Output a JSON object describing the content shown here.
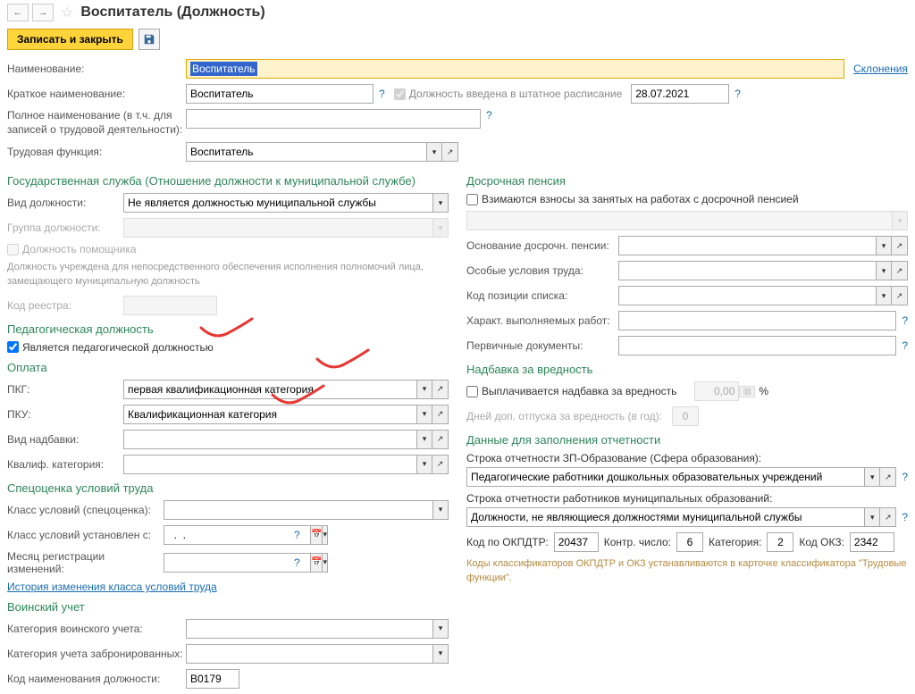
{
  "header": {
    "title": "Воспитатель (Должность)"
  },
  "actions": {
    "save_close": "Записать и закрыть"
  },
  "fields": {
    "name_label": "Наименование:",
    "name_value": "Воспитатель",
    "declensions_link": "Склонения",
    "short_name_label": "Краткое наименование:",
    "short_name_value": "Воспитатель",
    "in_schedule_label": "Должность введена в штатное расписание",
    "in_schedule_date": "28.07.2021",
    "full_name_label": "Полное наименование (в т.ч. для записей о трудовой деятельности):",
    "full_name_value": "",
    "labor_func_label": "Трудовая функция:",
    "labor_func_value": "Воспитатель"
  },
  "gov": {
    "header": "Государственная служба (Отношение должности к муниципальной службе)",
    "type_label": "Вид должности:",
    "type_value": "Не является должностью муниципальной службы",
    "group_label": "Группа должности:",
    "assistant_label": "Должность помощника",
    "assistant_note": "Должность учреждена для непосредственного обеспечения исполнения полномочий лица, замещающего муниципальную должность",
    "registry_label": "Код реестра:"
  },
  "pedagogical": {
    "header": "Педагогическая должность",
    "is_ped_label": "Является педагогической должностью"
  },
  "payment": {
    "header": "Оплата",
    "pkg_label": "ПКГ:",
    "pkg_value": "первая квалификационная категория",
    "pku_label": "ПКУ:",
    "pku_value": "Квалификационная категория",
    "bonus_label": "Вид надбавки:",
    "qualif_label": "Квалиф. категория:"
  },
  "special": {
    "header": "Спецоценка условий труда",
    "class_label": "Класс условий (спецоценка):",
    "class_from_label": "Класс условий установлен с:",
    "class_from_value": "  .  .    ",
    "month_label": "Месяц регистрации изменений:",
    "history_link": "История изменения класса условий труда"
  },
  "military": {
    "header": "Воинский учет",
    "cat_label": "Категория воинского учета:",
    "reserved_label": "Категория учета забронированных:",
    "code_label": "Код наименования должности:",
    "code_value": "В0179"
  },
  "pension": {
    "header": "Досрочная пенсия",
    "collect_label": "Взимаются взносы за занятых на работах с досрочной пенсией",
    "basis_label": "Основание досрочн. пенсии:",
    "conditions_label": "Особые условия труда:",
    "list_code_label": "Код позиции списка:",
    "work_label": "Характ. выполняемых работ:",
    "docs_label": "Первичные документы:"
  },
  "harm": {
    "header": "Надбавка за вредность",
    "pay_label": "Выплачивается надбавка за вредность",
    "pay_value": "0,00",
    "percent": "%",
    "days_label": "Дней доп. отпуска за вредность (в год):",
    "days_value": "0"
  },
  "reporting": {
    "header": "Данные для заполнения отчетности",
    "edu_label": "Строка отчетности ЗП-Образование (Сфера образования):",
    "edu_value": "Педагогические работники дошкольных образовательных учреждений",
    "mun_label": "Строка отчетности работников муниципальных образований:",
    "mun_value": "Должности, не являющиеся должностями муниципальной службы",
    "okpdtr_label": "Код по ОКПДТР:",
    "okpdtr_value": "20437",
    "kontr_label": "Контр. число:",
    "kontr_value": "6",
    "cat_label": "Категория:",
    "cat_value": "2",
    "okz_label": "Код ОКЗ:",
    "okz_value": "2342",
    "note": "Коды классификаторов ОКПДТР и ОКЗ устанавливаются в карточке классификатора \"Трудовые функции\"."
  }
}
